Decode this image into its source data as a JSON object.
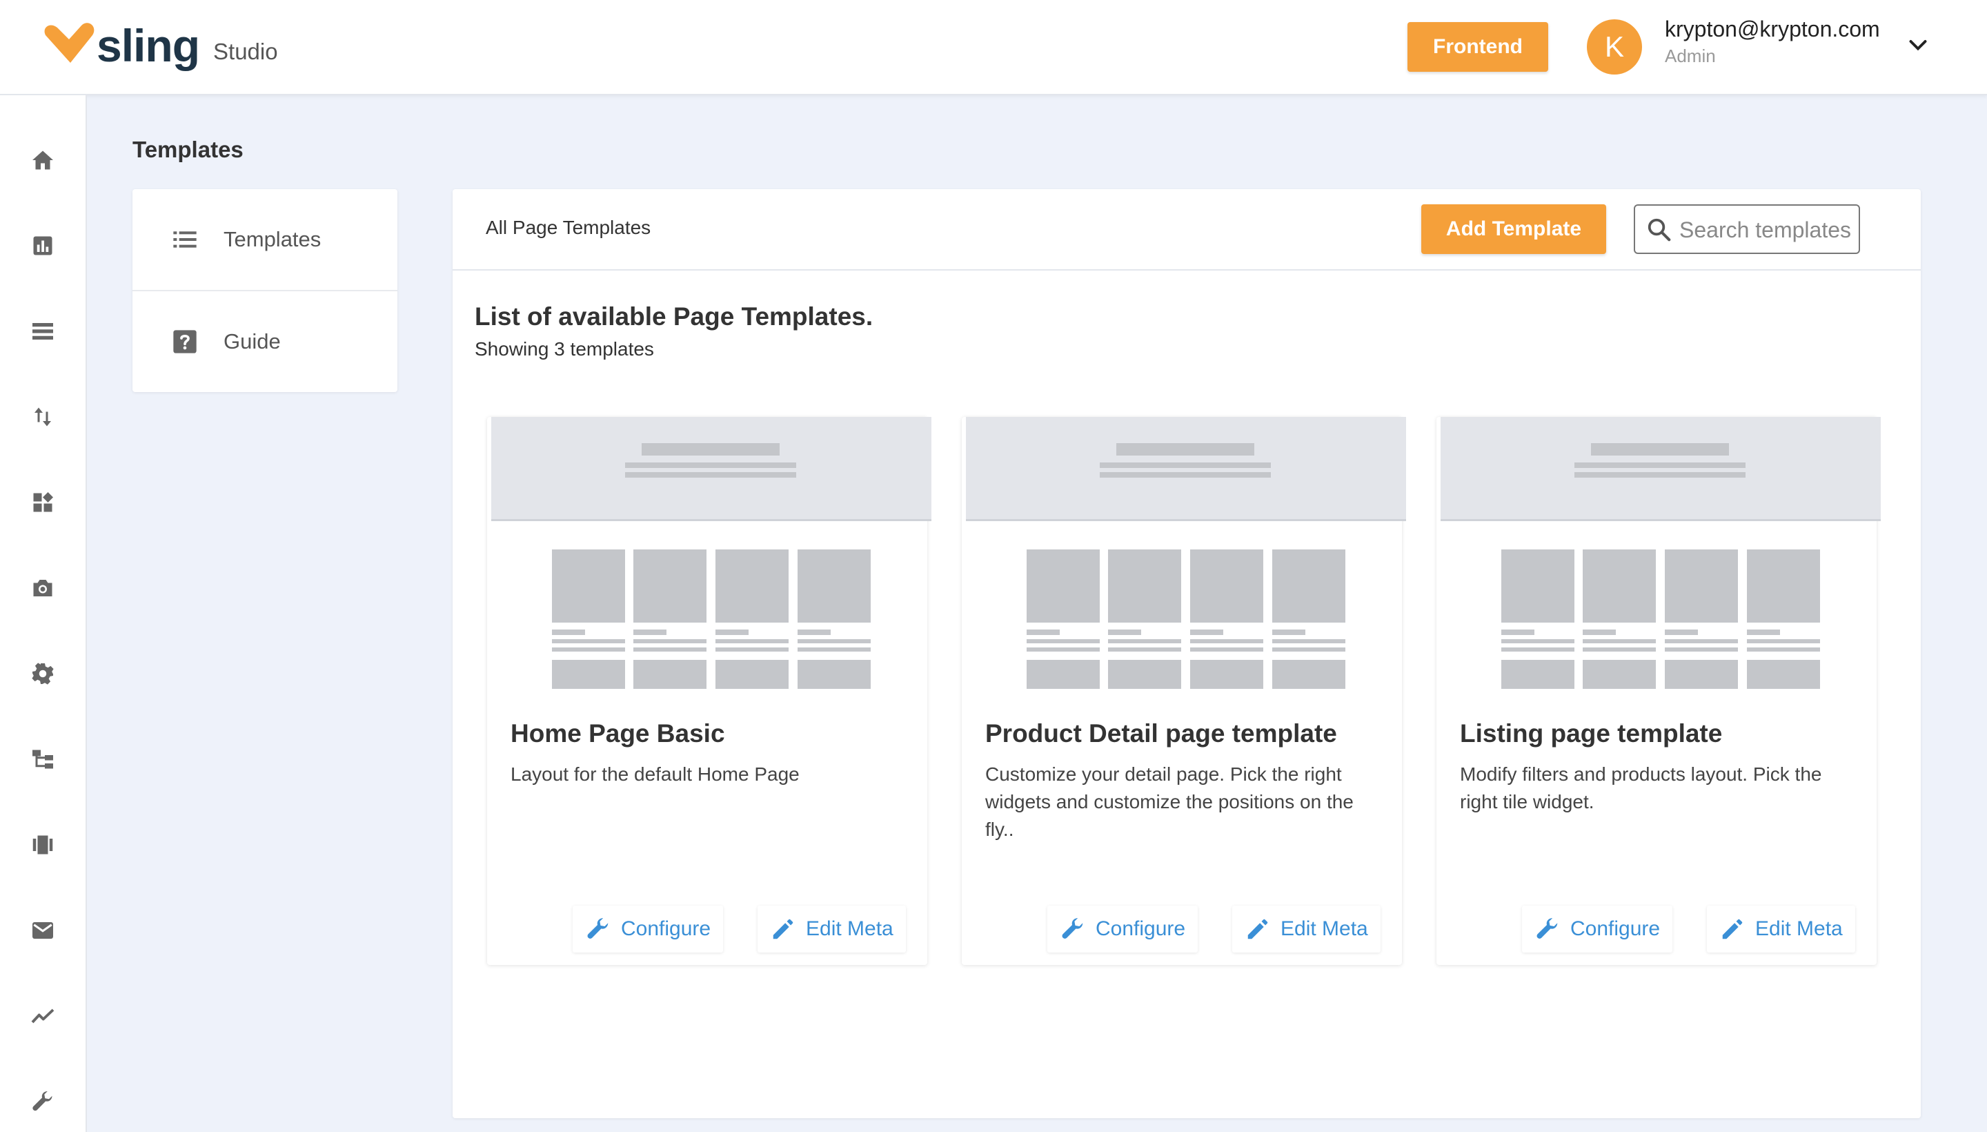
{
  "header": {
    "logo_word": "sling",
    "logo_sub": "Studio",
    "frontend_label": "Frontend",
    "user": {
      "initial": "K",
      "email": "krypton@krypton.com",
      "role": "Admin"
    }
  },
  "rail": {
    "items": [
      "home-icon",
      "bar-chart-icon",
      "list-icon",
      "sort-arrows-icon",
      "widgets-icon",
      "camera-icon",
      "gear-icon",
      "sitemap-icon",
      "carousel-icon",
      "mail-icon",
      "trend-line-icon",
      "wrench-icon"
    ]
  },
  "page": {
    "title": "Templates"
  },
  "subnav": {
    "items": [
      {
        "label": "Templates",
        "icon": "list-icon"
      },
      {
        "label": "Guide",
        "icon": "help-icon"
      }
    ]
  },
  "main": {
    "breadcrumb": "All Page Templates",
    "add_label": "Add Template",
    "search_placeholder": "Search templates",
    "heading": "List of available Page Templates.",
    "count": "Showing 3 templates",
    "cards": [
      {
        "title": "Home Page Basic",
        "description": "Layout for the default Home Page",
        "configure": "Configure",
        "edit_meta": "Edit Meta"
      },
      {
        "title": "Product Detail page template",
        "description": "Customize your detail page. Pick the right widgets and customize the positions on the fly..",
        "configure": "Configure",
        "edit_meta": "Edit Meta"
      },
      {
        "title": "Listing page template",
        "description": "Modify filters and products layout. Pick the right tile widget.",
        "configure": "Configure",
        "edit_meta": "Edit Meta"
      }
    ]
  },
  "colors": {
    "accent": "#f5a03a",
    "link": "#3a8fd6",
    "navy": "#1f3547",
    "background": "#eef2fa"
  }
}
